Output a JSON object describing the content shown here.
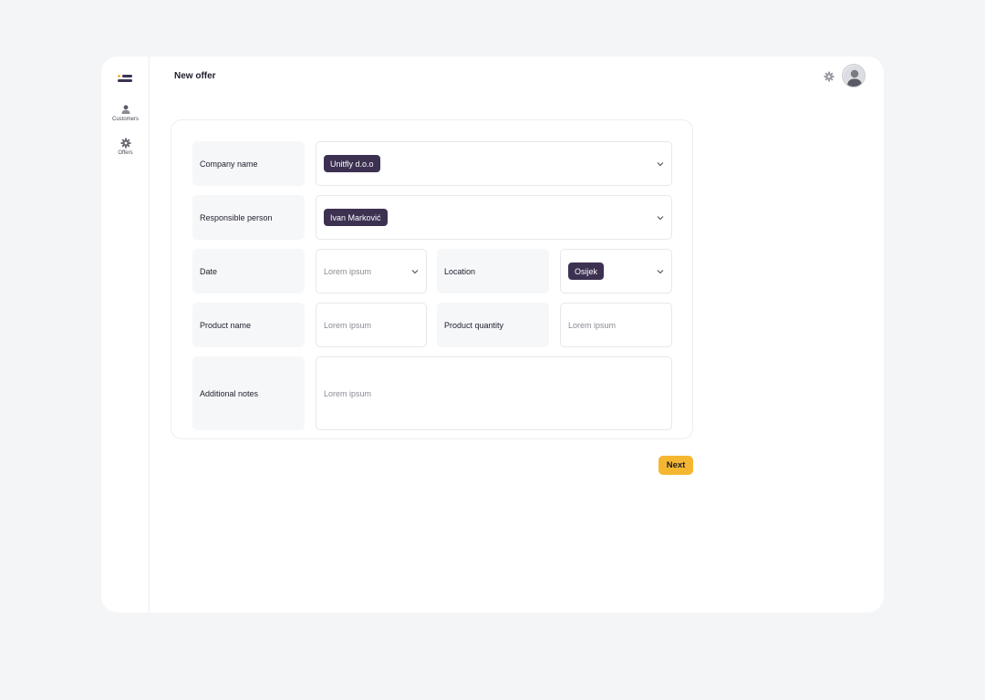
{
  "sidebar": {
    "items": [
      {
        "label": "Customers",
        "icon": "user-icon"
      },
      {
        "label": "Offers",
        "icon": "gear-icon"
      }
    ]
  },
  "header": {
    "title": "New offer"
  },
  "form": {
    "company_name": {
      "label": "Company name",
      "value": "Unitfly d.o.o"
    },
    "responsible_person": {
      "label": "Responsible person",
      "value": "Ivan Marković"
    },
    "date": {
      "label": "Date",
      "placeholder": "Lorem ipsum"
    },
    "location": {
      "label": "Location",
      "value": "Osijek"
    },
    "product_name": {
      "label": "Product name",
      "placeholder": "Lorem ipsum"
    },
    "product_quantity": {
      "label": "Product quantity",
      "placeholder": "Lorem ipsum"
    },
    "additional_notes": {
      "label": "Additional notes",
      "placeholder": "Lorem ipsum"
    }
  },
  "actions": {
    "next_label": "Next"
  },
  "colors": {
    "accent": "#f5b731",
    "chip": "#3d3152",
    "background": "#f4f5f7"
  }
}
